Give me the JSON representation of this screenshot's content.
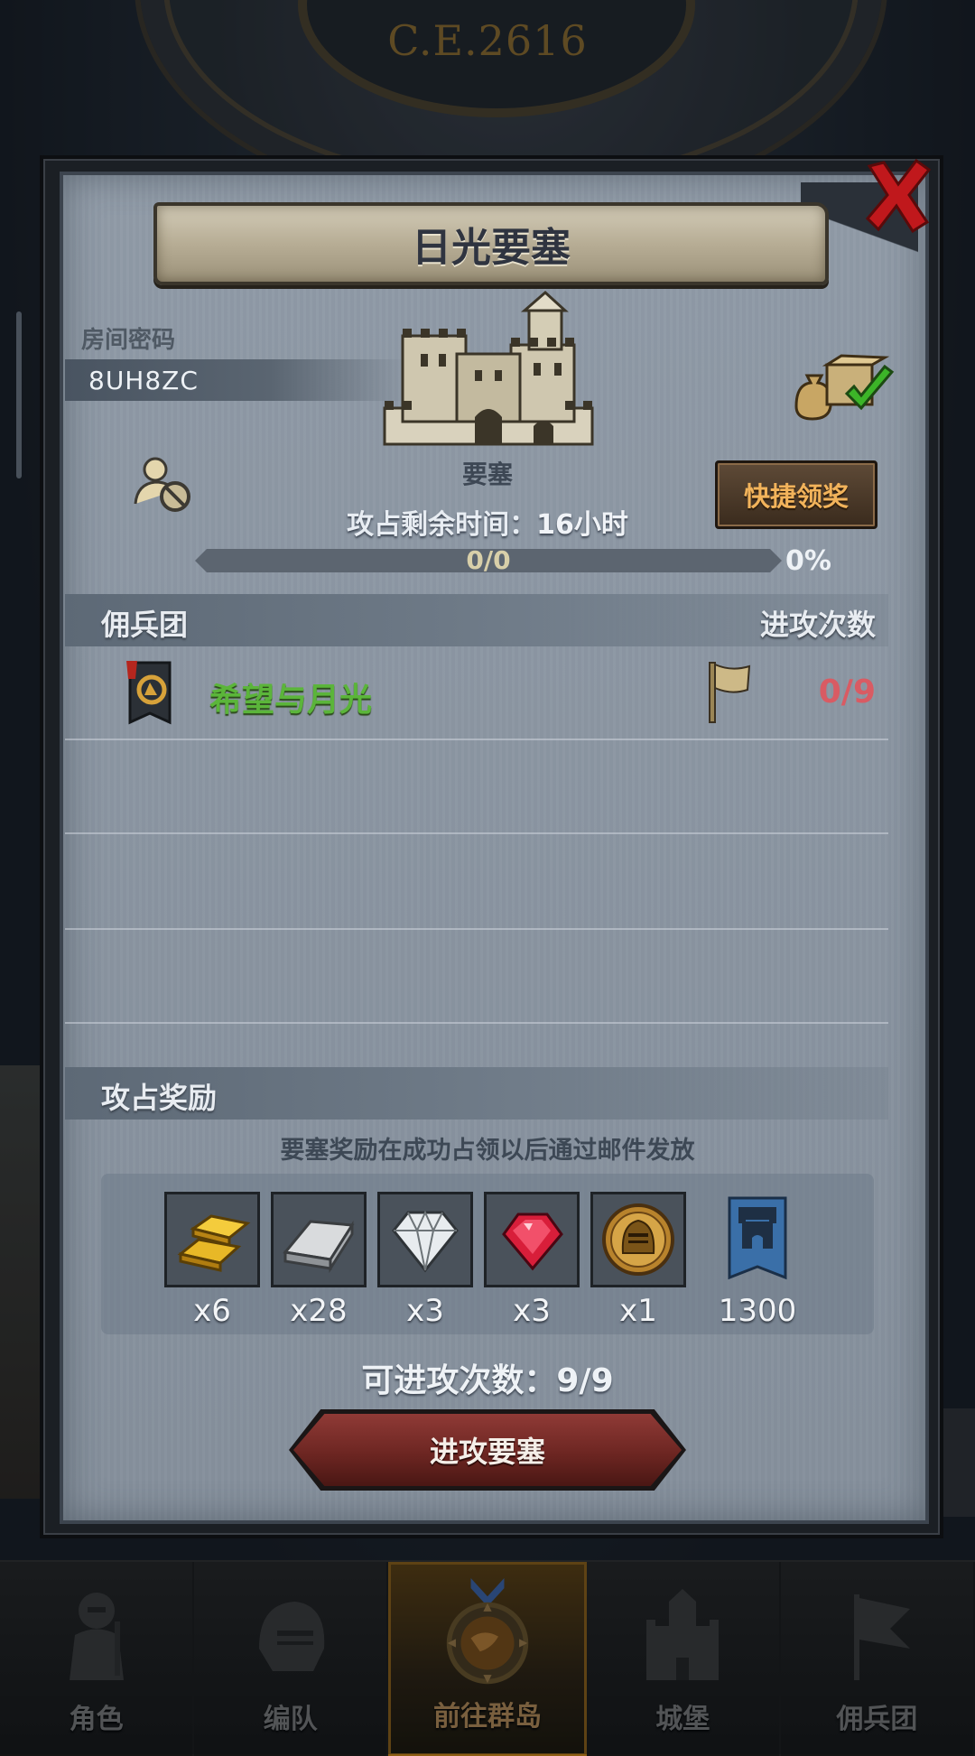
{
  "background": {
    "year": "C.E.2616"
  },
  "modal": {
    "title": "日光要塞",
    "room_code_label": "房间密码",
    "room_code": "8UH8ZC",
    "fortress_label": "要塞",
    "quick_claim_label": "快捷领奖",
    "remaining_time_label": "攻占剩余时间：",
    "remaining_time_value": "16小时",
    "progress": {
      "text": "0/0",
      "percent_text": "0%",
      "percent_value": 0
    },
    "mercenary_section": {
      "left_header": "佣兵团",
      "right_header": "进攻次数",
      "rows": [
        {
          "name": "希望与月光",
          "attacks": "0/9"
        }
      ]
    },
    "reward_section": {
      "header": "攻占奖励",
      "note": "要塞奖励在成功占领以后通过邮件发放",
      "items": [
        {
          "icon": "gold-bars-icon",
          "qty": "x6"
        },
        {
          "icon": "iron-ingot-icon",
          "qty": "x28"
        },
        {
          "icon": "diamond-icon",
          "qty": "x3"
        },
        {
          "icon": "ruby-icon",
          "qty": "x3"
        },
        {
          "icon": "knight-helmet-coin-icon",
          "qty": "x1"
        },
        {
          "icon": "fortress-banner-icon",
          "qty": "1300"
        }
      ]
    },
    "attack_count_label": "可进攻次数：",
    "attack_count_value": "9/9",
    "attack_button_label": "进攻要塞"
  },
  "bottom_nav": {
    "items": [
      {
        "label": "角色",
        "icon": "knight-icon",
        "active": false
      },
      {
        "label": "编队",
        "icon": "helmet-icon",
        "active": false
      },
      {
        "label": "前往群岛",
        "icon": "compass-icon",
        "active": true
      },
      {
        "label": "城堡",
        "icon": "castle-icon",
        "active": false
      },
      {
        "label": "佣兵团",
        "icon": "mercenary-icon",
        "active": false
      }
    ]
  },
  "colors": {
    "accent_gold": "#f2b35b",
    "merc_name_green": "#5bb53a",
    "attacks_red": "#d95b63",
    "close_red": "#c0181c"
  }
}
